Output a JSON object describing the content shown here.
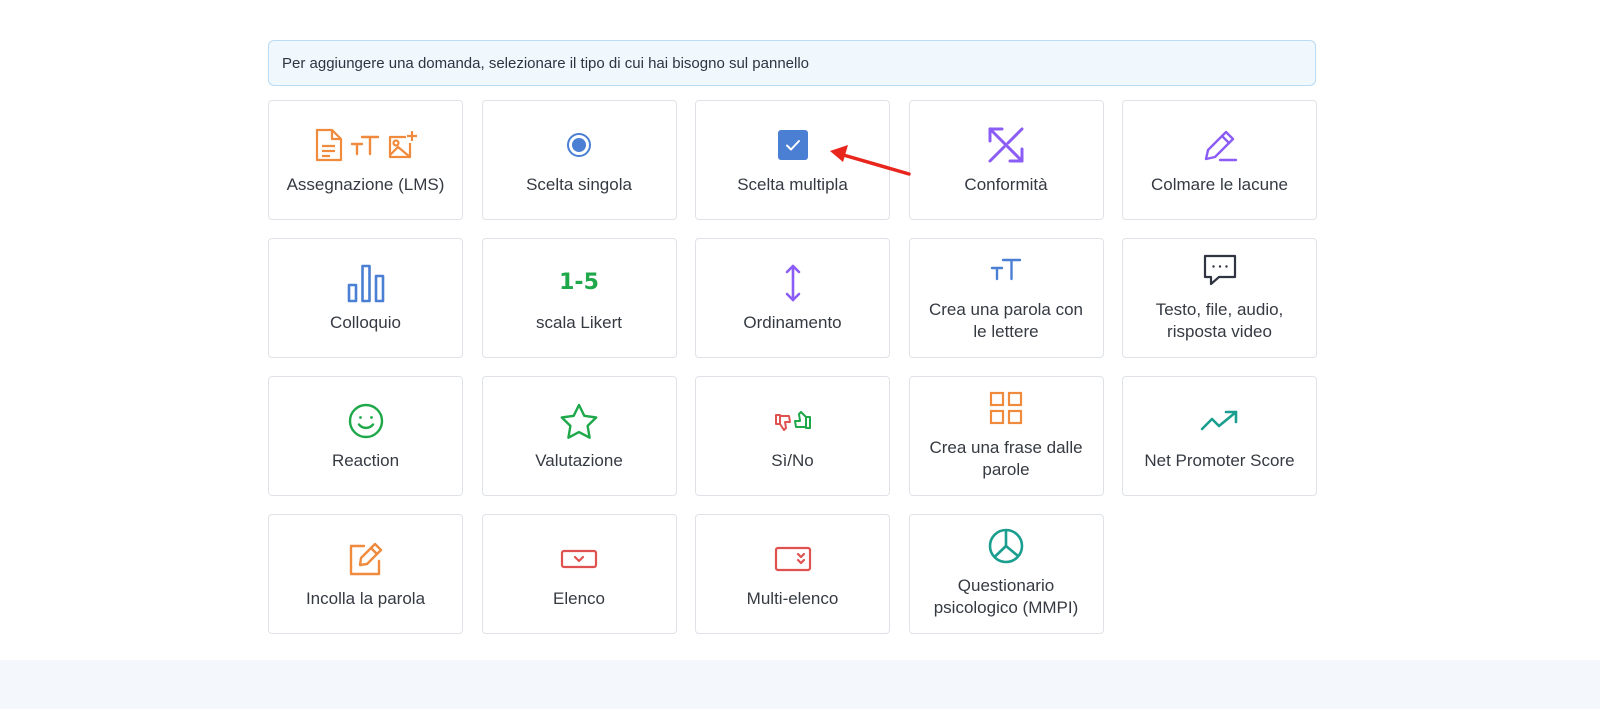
{
  "notice": "Per aggiungere una domanda, selezionare il tipo di cui hai bisogno sul pannello",
  "cards": {
    "assignment": "Assegnazione (LMS)",
    "single_choice": "Scelta singola",
    "multiple_choice": "Scelta multipla",
    "matching": "Conformità",
    "fill_gaps": "Colmare le lacune",
    "interview": "Colloquio",
    "likert": "scala Likert",
    "likert_icon": "1-5",
    "ordering": "Ordinamento",
    "word_from_letters": "Crea una parola con le lettere",
    "text_file_audio_video": "Testo, file, audio, risposta video",
    "reaction": "Reaction",
    "rating": "Valutazione",
    "yes_no": "Sì/No",
    "sentence_from_words": "Crea una frase dalle parole",
    "nps": "Net Promoter Score",
    "paste_word": "Incolla la parola",
    "list": "Elenco",
    "multi_list": "Multi-elenco",
    "mmpi": "Questionario psicologico (MMPI)"
  },
  "icons": {
    "assignment": [
      "document-icon",
      "text-size-icon",
      "image-add-icon"
    ],
    "single_choice": "radio-icon",
    "multiple_choice": "checkbox-icon",
    "matching": "arrows-diagonal-icon",
    "fill_gaps": "pencil-icon",
    "interview": "bar-chart-icon",
    "ordering": "arrows-vertical-icon",
    "word_from_letters": "text-size-icon",
    "text_file_audio_video": "chat-bubble-icon",
    "reaction": "smiley-icon",
    "rating": "star-icon",
    "yes_no": "thumbs-icon",
    "sentence_from_words": "grid-icon",
    "nps": "trending-up-icon",
    "paste_word": "edit-icon",
    "list": "dropdown-icon",
    "multi_list": "multi-dropdown-icon",
    "mmpi": "pie-chart-icon"
  },
  "colors": {
    "orange": "#f08a3c",
    "blue": "#4a7fd4",
    "purple": "#8b5cf6",
    "green": "#1ea84a",
    "teal": "#1a9e8f",
    "red": "#e0524f",
    "dark": "#2e3440",
    "annotation_arrow": "#e8261e"
  }
}
